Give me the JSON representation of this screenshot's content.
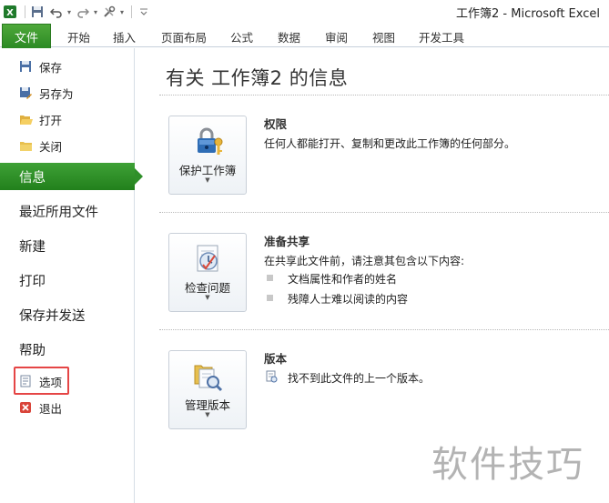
{
  "window": {
    "title": "工作簿2 - Microsoft Excel"
  },
  "ribbon": {
    "file_tab": "文件",
    "tabs": [
      "开始",
      "插入",
      "页面布局",
      "公式",
      "数据",
      "审阅",
      "视图",
      "开发工具"
    ]
  },
  "backstage": {
    "commands": [
      {
        "label": "保存",
        "icon": "save-icon"
      },
      {
        "label": "另存为",
        "icon": "save-as-icon"
      },
      {
        "label": "打开",
        "icon": "open-folder-icon"
      },
      {
        "label": "关闭",
        "icon": "close-folder-icon"
      }
    ],
    "nav": [
      {
        "label": "信息",
        "active": true
      },
      {
        "label": "最近所用文件"
      },
      {
        "label": "新建"
      },
      {
        "label": "打印"
      },
      {
        "label": "保存并发送"
      },
      {
        "label": "帮助"
      }
    ],
    "options_label": "选项",
    "exit_label": "退出"
  },
  "info": {
    "title": "有关 工作簿2 的信息",
    "permissions": {
      "button_label": "保护工作簿",
      "heading": "权限",
      "description": "任何人都能打开、复制和更改此工作簿的任何部分。"
    },
    "prepare": {
      "button_label": "检查问题",
      "heading": "准备共享",
      "description": "在共享此文件前，请注意其包含以下内容:",
      "items": [
        "文档属性和作者的姓名",
        "残障人士难以阅读的内容"
      ]
    },
    "versions": {
      "button_label": "管理版本",
      "heading": "版本",
      "description": "找不到此文件的上一个版本。"
    }
  },
  "watermark": "软件技巧",
  "colors": {
    "accent_green": "#2e8b26",
    "highlight_red": "#e54545"
  }
}
